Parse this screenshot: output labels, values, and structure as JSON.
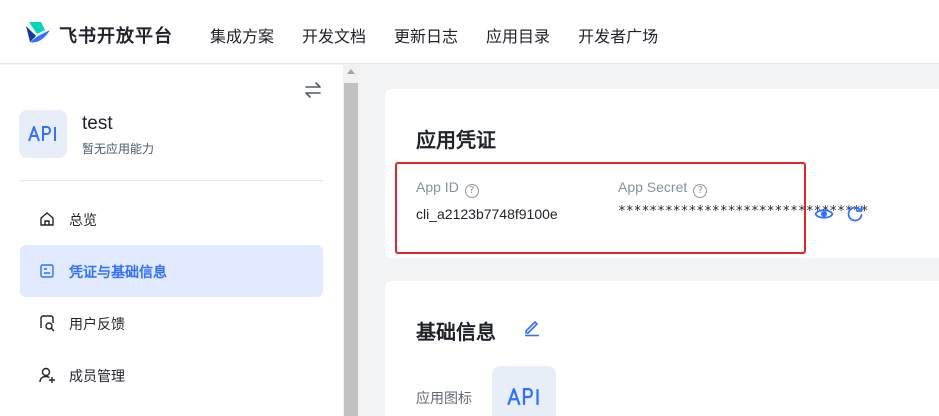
{
  "brand": {
    "name": "飞书开放平台",
    "logo_icon": "feishu-logo-icon"
  },
  "nav": {
    "items": [
      "集成方案",
      "开发文档",
      "更新日志",
      "应用目录",
      "开发者广场"
    ]
  },
  "sidebar": {
    "collapse_icon": "swap-icon",
    "app": {
      "name": "test",
      "subtitle": "暂无应用能力",
      "icon_text": "API"
    },
    "items": [
      {
        "label": "总览",
        "icon": "home-icon",
        "active": false
      },
      {
        "label": "凭证与基础信息",
        "icon": "credential-icon",
        "active": true
      },
      {
        "label": "用户反馈",
        "icon": "feedback-icon",
        "active": false
      },
      {
        "label": "成员管理",
        "icon": "member-icon",
        "active": false
      }
    ]
  },
  "credentials": {
    "title": "应用凭证",
    "app_id": {
      "label": "App ID",
      "value": "cli_a2123b7748f9100e"
    },
    "app_secret": {
      "label": "App Secret",
      "value": "********************************"
    },
    "view_icon": "eye-icon",
    "refresh_icon": "refresh-icon"
  },
  "basic_info": {
    "title": "基础信息",
    "edit_icon": "edit-icon",
    "app_icon_label": "应用图标",
    "app_icon_text": "API"
  },
  "colors": {
    "accent": "#3370ff",
    "highlight_border": "#e3242b",
    "active_bg": "#e1eaff"
  }
}
